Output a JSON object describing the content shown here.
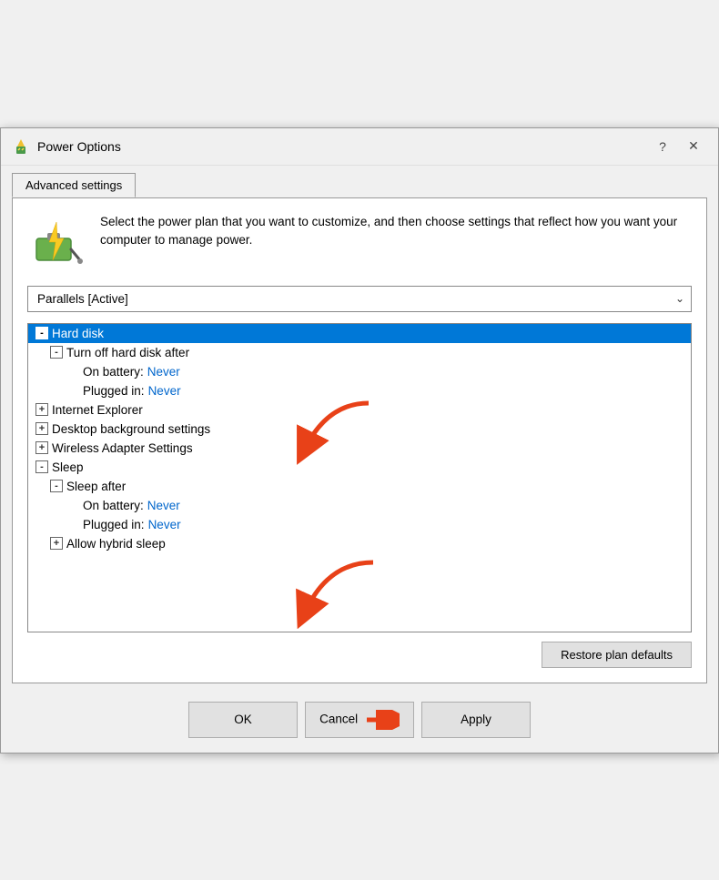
{
  "window": {
    "title": "Power Options",
    "help_label": "?",
    "close_label": "✕"
  },
  "tab": {
    "label": "Advanced settings"
  },
  "description": {
    "text": "Select the power plan that you want to customize, and then choose settings that reflect how you want your computer to manage power."
  },
  "plan_dropdown": {
    "value": "Parallels [Active]",
    "placeholder": "Parallels [Active]"
  },
  "tree": {
    "items": [
      {
        "id": "hard-disk",
        "indent": 0,
        "expand": "-",
        "label": "Hard disk",
        "selected": true
      },
      {
        "id": "turn-off-hard-disk",
        "indent": 1,
        "expand": "-",
        "label": "Turn off hard disk after",
        "selected": false
      },
      {
        "id": "on-battery-hard",
        "indent": 2,
        "expand": null,
        "label": "On battery: ",
        "value": "Never",
        "selected": false
      },
      {
        "id": "plugged-in-hard",
        "indent": 2,
        "expand": null,
        "label": "Plugged in: ",
        "value": "Never",
        "selected": false
      },
      {
        "id": "internet-explorer",
        "indent": 0,
        "expand": "+",
        "label": "Internet Explorer",
        "selected": false
      },
      {
        "id": "desktop-background",
        "indent": 0,
        "expand": "+",
        "label": "Desktop background settings",
        "selected": false
      },
      {
        "id": "wireless-adapter",
        "indent": 0,
        "expand": "+",
        "label": "Wireless Adapter Settings",
        "selected": false
      },
      {
        "id": "sleep",
        "indent": 0,
        "expand": "-",
        "label": "Sleep",
        "selected": false
      },
      {
        "id": "sleep-after",
        "indent": 1,
        "expand": "-",
        "label": "Sleep after",
        "selected": false
      },
      {
        "id": "on-battery-sleep",
        "indent": 2,
        "expand": null,
        "label": "On battery: ",
        "value": "Never",
        "selected": false
      },
      {
        "id": "plugged-in-sleep",
        "indent": 2,
        "expand": null,
        "label": "Plugged in: ",
        "value": "Never",
        "selected": false
      },
      {
        "id": "allow-hybrid-sleep",
        "indent": 1,
        "expand": "+",
        "label": "Allow hybrid sleep",
        "selected": false
      }
    ]
  },
  "restore_btn": {
    "label": "Restore plan defaults"
  },
  "buttons": {
    "ok": "OK",
    "cancel": "Cancel",
    "apply": "Apply"
  }
}
